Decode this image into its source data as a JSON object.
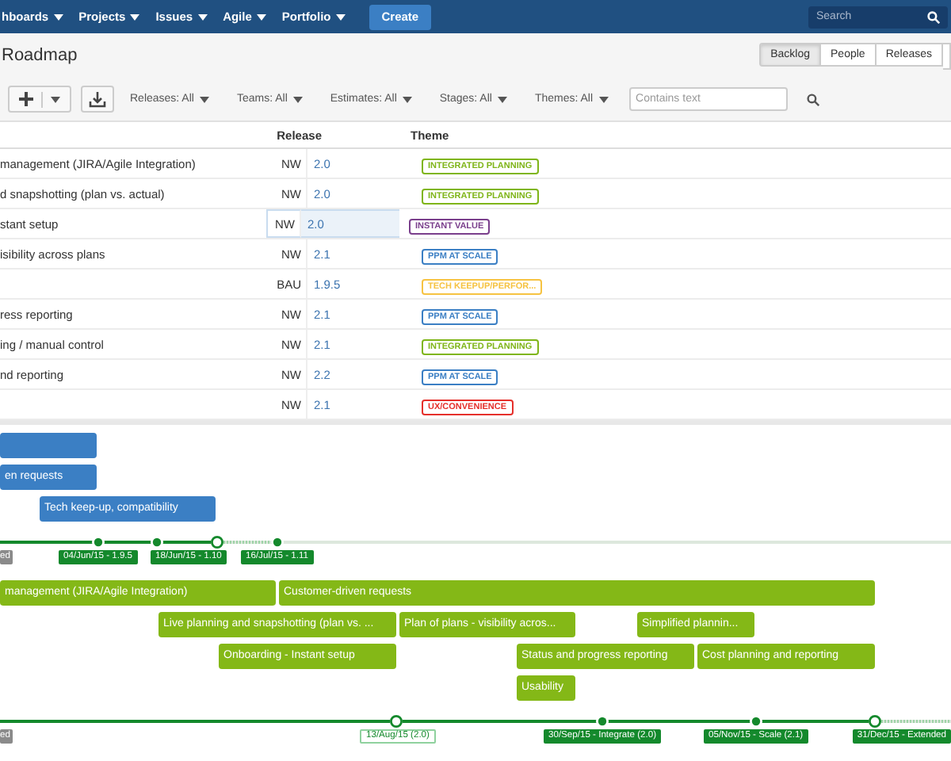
{
  "nav": {
    "items": [
      {
        "label": "hboards"
      },
      {
        "label": "Projects"
      },
      {
        "label": "Issues"
      },
      {
        "label": "Agile"
      },
      {
        "label": "Portfolio"
      }
    ],
    "create": "Create",
    "search": {
      "placeholder": "Search"
    }
  },
  "page_title": "Roadmap",
  "view_tabs": [
    {
      "label": "Backlog",
      "selected": true
    },
    {
      "label": "People",
      "selected": false
    },
    {
      "label": "Releases",
      "selected": false
    }
  ],
  "filters": [
    {
      "label": "Releases: All"
    },
    {
      "label": "Teams: All"
    },
    {
      "label": "Estimates: All"
    },
    {
      "label": "Stages: All"
    },
    {
      "label": "Themes: All"
    }
  ],
  "text_filter": {
    "placeholder": "Contains text"
  },
  "table": {
    "columns": [
      "Release",
      "Theme"
    ],
    "rows": [
      {
        "title": "management (JIRA/Agile Integration)",
        "team": "NW",
        "release": "2.0",
        "theme": "INTEGRATED PLANNING",
        "color": "#7fb519",
        "selected": false
      },
      {
        "title": "d snapshotting (plan vs. actual)",
        "team": "NW",
        "release": "2.0",
        "theme": "INTEGRATED PLANNING",
        "color": "#7fb519",
        "selected": false
      },
      {
        "title": "stant setup",
        "team": "NW",
        "release": "2.0",
        "theme": "INSTANT VALUE",
        "color": "#7a3f8c",
        "selected": true
      },
      {
        "title": "isibility across plans",
        "team": "NW",
        "release": "2.1",
        "theme": "PPM AT SCALE",
        "color": "#3b7fc4",
        "selected": false
      },
      {
        "team": "BAU",
        "release": "1.9.5",
        "theme": "TECH KEEPUP/PERFOR...",
        "color": "#f6c342",
        "selected": false
      },
      {
        "title": "ress reporting",
        "team": "NW",
        "release": "2.1",
        "theme": "PPM AT SCALE",
        "color": "#3b7fc4",
        "selected": false
      },
      {
        "title": "ing / manual control",
        "team": "NW",
        "release": "2.1",
        "theme": "INTEGRATED PLANNING",
        "color": "#7fb519",
        "selected": false
      },
      {
        "title": "nd reporting",
        "team": "NW",
        "release": "2.2",
        "theme": "PPM AT SCALE",
        "color": "#3b7fc4",
        "selected": false
      },
      {
        "team": "NW",
        "release": "2.1",
        "theme": "UX/CONVENIENCE",
        "color": "#e5302b",
        "selected": false
      }
    ]
  },
  "timeline": {
    "lanes": [
      {
        "color": "#3b7fc4",
        "bars": [
          {
            "label": "en requests"
          },
          {
            "label": "Tech keep-up, compatibility"
          }
        ],
        "markers": [
          {
            "label": "ed",
            "kind": "released"
          },
          {
            "label": "04/Jun/15 - 1.9.5",
            "kind": "release"
          },
          {
            "label": "18/Jun/15 - 1.10",
            "kind": "release"
          },
          {
            "label": "16/Jul/15 - 1.11",
            "kind": "release"
          }
        ]
      },
      {
        "color": "#84b817",
        "bars": [
          {
            "label": "management (JIRA/Agile Integration)"
          },
          {
            "label": "Customer-driven requests"
          },
          {
            "label": "Live planning and snapshotting (plan vs. ..."
          },
          {
            "label": "Plan of plans - visibility acros..."
          },
          {
            "label": "Simplified plannin..."
          },
          {
            "label": "Onboarding - Instant setup"
          },
          {
            "label": "Status and progress reporting"
          },
          {
            "label": "Cost planning and reporting"
          },
          {
            "label": "Usability"
          }
        ],
        "markers": [
          {
            "label": "ed",
            "kind": "released"
          },
          {
            "label": "13/Aug/15 (2.0)",
            "kind": "target"
          },
          {
            "label": "30/Sep/15 - Integrate (2.0)",
            "kind": "release"
          },
          {
            "label": "05/Nov/15 - Scale (2.1)",
            "kind": "release"
          },
          {
            "label": "31/Dec/15 - Extended",
            "kind": "release"
          }
        ]
      }
    ]
  }
}
